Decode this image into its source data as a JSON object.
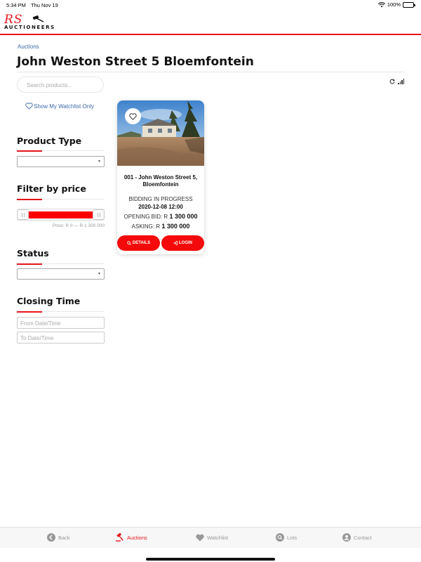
{
  "status_bar": {
    "time": "5:34 PM",
    "date": "Thu Nov 19",
    "battery": "100%"
  },
  "brand": {
    "logo_mark": "RS",
    "logo_word": "AUCTIONEERS",
    "accent": "#e5141b"
  },
  "breadcrumb": "Auctions",
  "page_title": "John Weston Street 5 Bloemfontein",
  "sidebar": {
    "search_placeholder": "Search products...",
    "watchlist_label": "Show My Watchlist Only",
    "product_type": {
      "title": "Product Type",
      "selected": ""
    },
    "price": {
      "title": "Filter by price",
      "label": "Price: R 0 — R 1 300 000",
      "min_fraction": 0,
      "max_fraction": 1
    },
    "status": {
      "title": "Status",
      "selected": ""
    },
    "closing_time": {
      "title": "Closing Time",
      "from_placeholder": "From Date/Time",
      "to_placeholder": "To Date/Time"
    }
  },
  "product": {
    "title": "001 - John Weston Street 5, Bloemfontein",
    "status": "BIDDING IN PROGRESS",
    "closing": "2020-12-08 12:00",
    "opening_label": "OPENING BID: R",
    "opening_value": "1 300 000",
    "asking_label": "ASKING: R",
    "asking_value": "1 300 000",
    "details_label": "DETAILS",
    "login_label": "LOGIN",
    "button_color": "#f40a0a"
  },
  "tabs": [
    {
      "label": "Back",
      "icon": "back-icon",
      "active": false
    },
    {
      "label": "Auctions",
      "icon": "gavel-icon",
      "active": true
    },
    {
      "label": "Watchlist",
      "icon": "heart-icon",
      "active": false
    },
    {
      "label": "Lots",
      "icon": "search-icon",
      "active": false
    },
    {
      "label": "Contact",
      "icon": "user-icon",
      "active": false
    }
  ]
}
